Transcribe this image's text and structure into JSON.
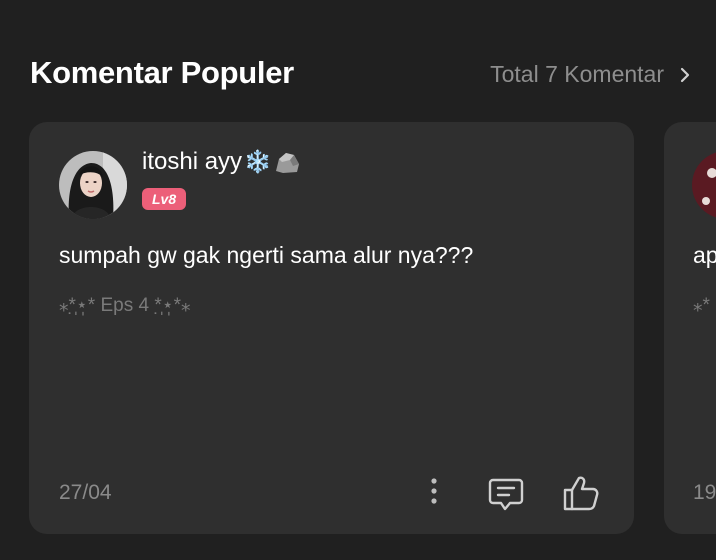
{
  "header": {
    "title": "Komentar Populer",
    "total_label": "Total 7 Komentar",
    "total_icon": "chevron-right-icon"
  },
  "comments": [
    {
      "username": "itoshi ayy",
      "username_emojis": [
        "❄️",
        "🪨"
      ],
      "level": "Lv8",
      "text": "sumpah gw gak ngerti sama alur nya???",
      "episode_tag": "⁎*̣̩⋆̩*  Eps 4 *̣̩⋆̩*⁎",
      "date": "27/04",
      "actions": [
        "more-icon",
        "reply-icon",
        "like-icon"
      ]
    },
    {
      "text": "ap",
      "episode_tag": "⁎*",
      "date": "19"
    }
  ],
  "colors": {
    "background": "#202020",
    "card": "#2f2f2f",
    "level_badge": "#ec5f79",
    "muted_text": "#8a8a8a"
  }
}
